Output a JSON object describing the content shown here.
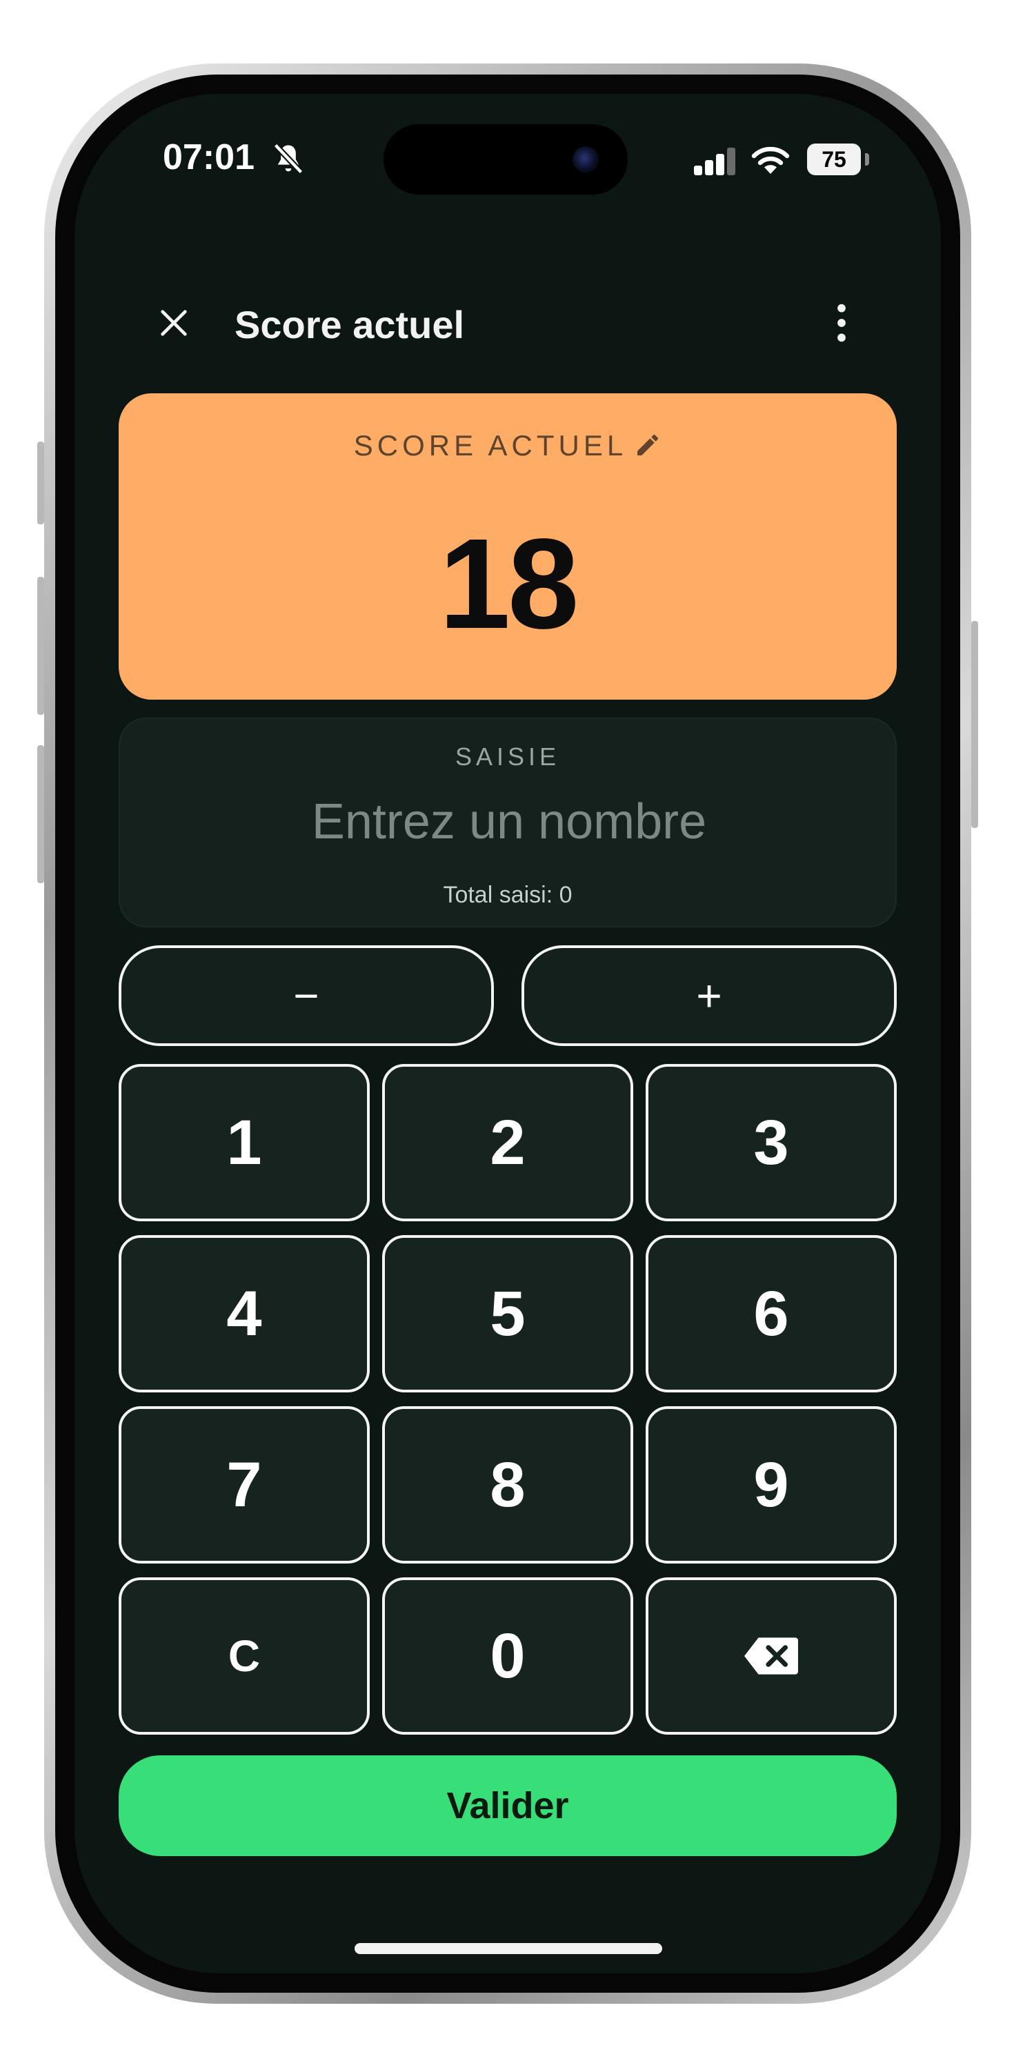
{
  "status_bar": {
    "time": "07:01",
    "battery": "75",
    "icons": [
      "bell-slash-icon",
      "cellular-signal-icon",
      "wifi-icon",
      "battery-icon"
    ]
  },
  "header": {
    "title": "Score actuel",
    "close_icon": "close-icon",
    "menu_icon": "more-vertical-icon"
  },
  "score_card": {
    "label": "SCORE ACTUEL",
    "value": "18",
    "edit_icon": "pencil-icon",
    "color": "#ffad66"
  },
  "input_card": {
    "label": "SAISIE",
    "placeholder": "Entrez un nombre",
    "value": "",
    "total": "Total saisi: 0"
  },
  "sign_buttons": {
    "minus": "−",
    "plus": "+"
  },
  "keypad": {
    "keys": [
      "1",
      "2",
      "3",
      "4",
      "5",
      "6",
      "7",
      "8",
      "9",
      "C",
      "0"
    ],
    "backspace_icon": "backspace-icon"
  },
  "submit": {
    "label": "Valider",
    "color": "#38de78"
  },
  "theme": {
    "background": "#0c1612",
    "border": "#f4f4f4"
  }
}
